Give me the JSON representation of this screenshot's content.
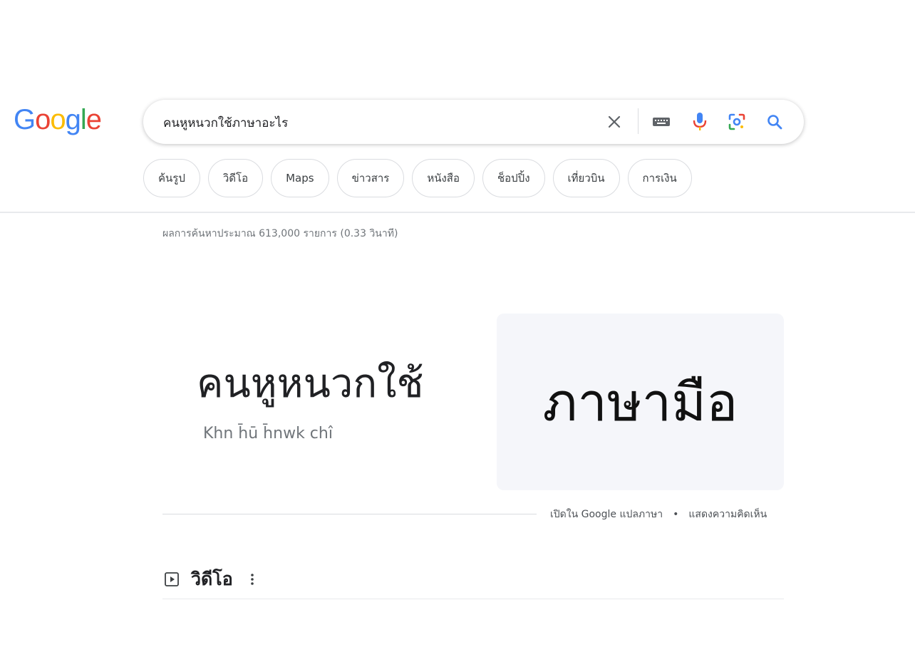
{
  "logo": {
    "text": "Google",
    "letters": [
      {
        "ch": "G",
        "color": "#4285F4"
      },
      {
        "ch": "o",
        "color": "#EA4335"
      },
      {
        "ch": "o",
        "color": "#FBBC05"
      },
      {
        "ch": "g",
        "color": "#4285F4"
      },
      {
        "ch": "l",
        "color": "#34A853"
      },
      {
        "ch": "e",
        "color": "#EA4335"
      }
    ]
  },
  "search": {
    "query": "คนหูหนวกใช้ภาษาอะไร",
    "icons": [
      "close-icon",
      "keyboard-icon",
      "microphone-icon",
      "lens-icon",
      "search-icon"
    ]
  },
  "chips": [
    {
      "label": "ค้นรูป"
    },
    {
      "label": "วิดีโอ"
    },
    {
      "label": "Maps"
    },
    {
      "label": "ข่าวสาร"
    },
    {
      "label": "หนังสือ"
    },
    {
      "label": "ช็อปปิ้ง"
    },
    {
      "label": "เที่ยวบิน"
    },
    {
      "label": "การเงิน"
    }
  ],
  "result_stats": "ผลการค้นหาประมาณ 613,000 รายการ (0.33 วินาที)",
  "translation": {
    "source_text": "คนหูหนวกใช้",
    "transliteration": "Khn h̄ū h̄nwk chı̂",
    "translated_text": "ภาษามือ",
    "open_link": "เปิดใน Google แปลภาษา",
    "separator": "•",
    "feedback_link": "แสดงความคิดเห็น"
  },
  "videos": {
    "title": "วิดีโอ"
  },
  "colors": {
    "accent_blue": "#1a73e8",
    "mic_blue": "#4285F4",
    "mic_red": "#EA4335",
    "translate_bg": "#f5f6fa"
  }
}
